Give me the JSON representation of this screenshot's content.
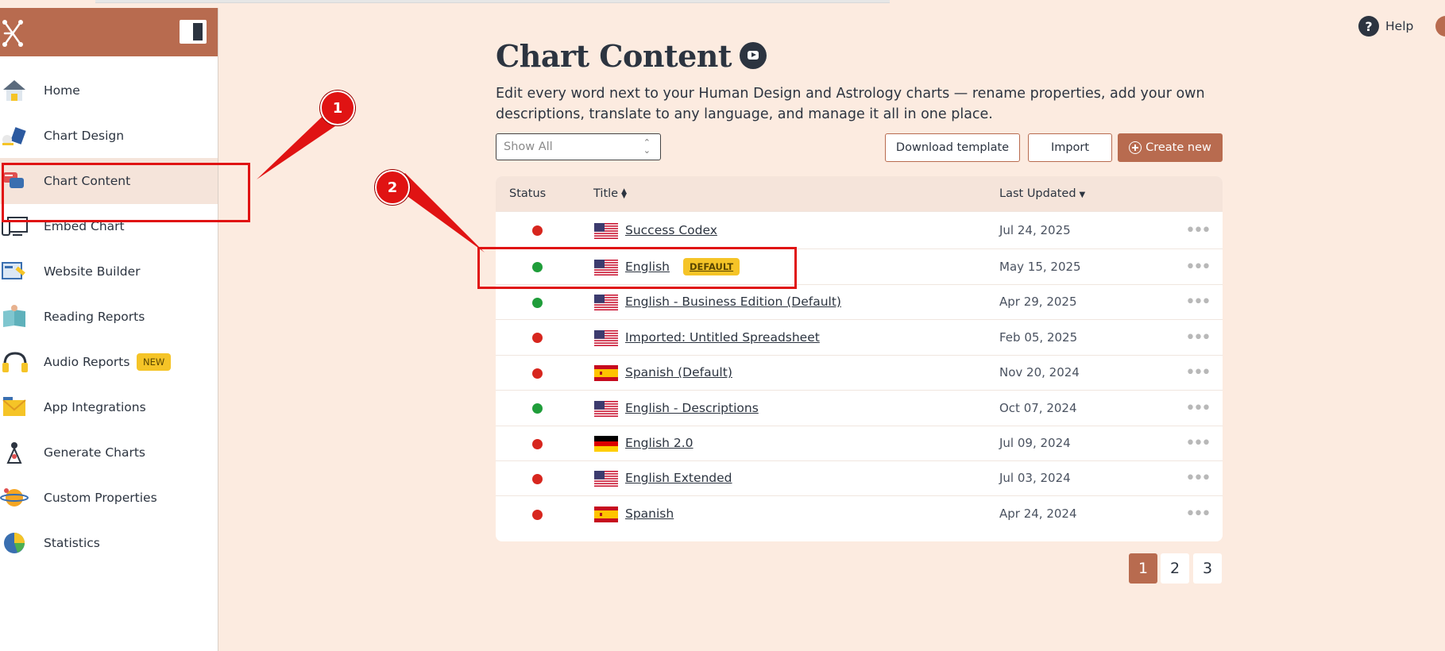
{
  "sidebar": {
    "items": [
      {
        "label": "Home",
        "icon": "home-icon"
      },
      {
        "label": "Chart Design",
        "icon": "chart-design-icon"
      },
      {
        "label": "Chart Content",
        "icon": "chart-content-icon",
        "active": true
      },
      {
        "label": "Embed Chart",
        "icon": "embed-chart-icon"
      },
      {
        "label": "Website Builder",
        "icon": "website-builder-icon"
      },
      {
        "label": "Reading Reports",
        "icon": "reading-reports-icon"
      },
      {
        "label": "Audio Reports",
        "icon": "audio-reports-icon",
        "badge": "NEW"
      },
      {
        "label": "App Integrations",
        "icon": "app-integrations-icon"
      },
      {
        "label": "Generate Charts",
        "icon": "generate-charts-icon"
      },
      {
        "label": "Custom Properties",
        "icon": "custom-properties-icon"
      },
      {
        "label": "Statistics",
        "icon": "statistics-icon"
      }
    ]
  },
  "header": {
    "help_label": "Help"
  },
  "main": {
    "title": "Chart Content",
    "subtitle": "Edit every word next to your Human Design and Astrology charts — rename properties, add your own descriptions, translate to any language, and manage it all in one place.",
    "filter": {
      "value": "Show All"
    },
    "buttons": {
      "download_template": "Download template",
      "import": "Import",
      "create_new": "Create new"
    },
    "table": {
      "columns": {
        "status": "Status",
        "title": "Title",
        "last_updated": "Last Updated"
      },
      "rows": [
        {
          "status": "red",
          "flag": "us",
          "title": "Success Codex",
          "date": "Jul 24, 2025"
        },
        {
          "status": "green",
          "flag": "us",
          "title": "English",
          "badge": "DEFAULT",
          "date": "May 15, 2025"
        },
        {
          "status": "green",
          "flag": "us",
          "title": "English - Business Edition (Default)",
          "date": "Apr 29, 2025"
        },
        {
          "status": "red",
          "flag": "us",
          "title": "Imported: Untitled Spreadsheet",
          "date": "Feb 05, 2025"
        },
        {
          "status": "red",
          "flag": "es",
          "title": "Spanish (Default)",
          "date": "Nov 20, 2024"
        },
        {
          "status": "green",
          "flag": "us",
          "title": "English - Descriptions",
          "date": "Oct 07, 2024"
        },
        {
          "status": "red",
          "flag": "de",
          "title": "English 2.0",
          "date": "Jul 09, 2024"
        },
        {
          "status": "red",
          "flag": "us",
          "title": "English Extended",
          "date": "Jul 03, 2024"
        },
        {
          "status": "red",
          "flag": "es",
          "title": "Spanish",
          "date": "Apr 24, 2024"
        }
      ]
    },
    "pagination": {
      "pages": [
        "1",
        "2",
        "3"
      ],
      "current": "1"
    }
  },
  "annotations": {
    "step1": "1",
    "step2": "2"
  },
  "colors": {
    "accent": "#b86b4f",
    "status_red": "#d7261e",
    "status_green": "#1f9d3a",
    "badge_yellow": "#f5c427",
    "annotation_red": "#e01313"
  }
}
